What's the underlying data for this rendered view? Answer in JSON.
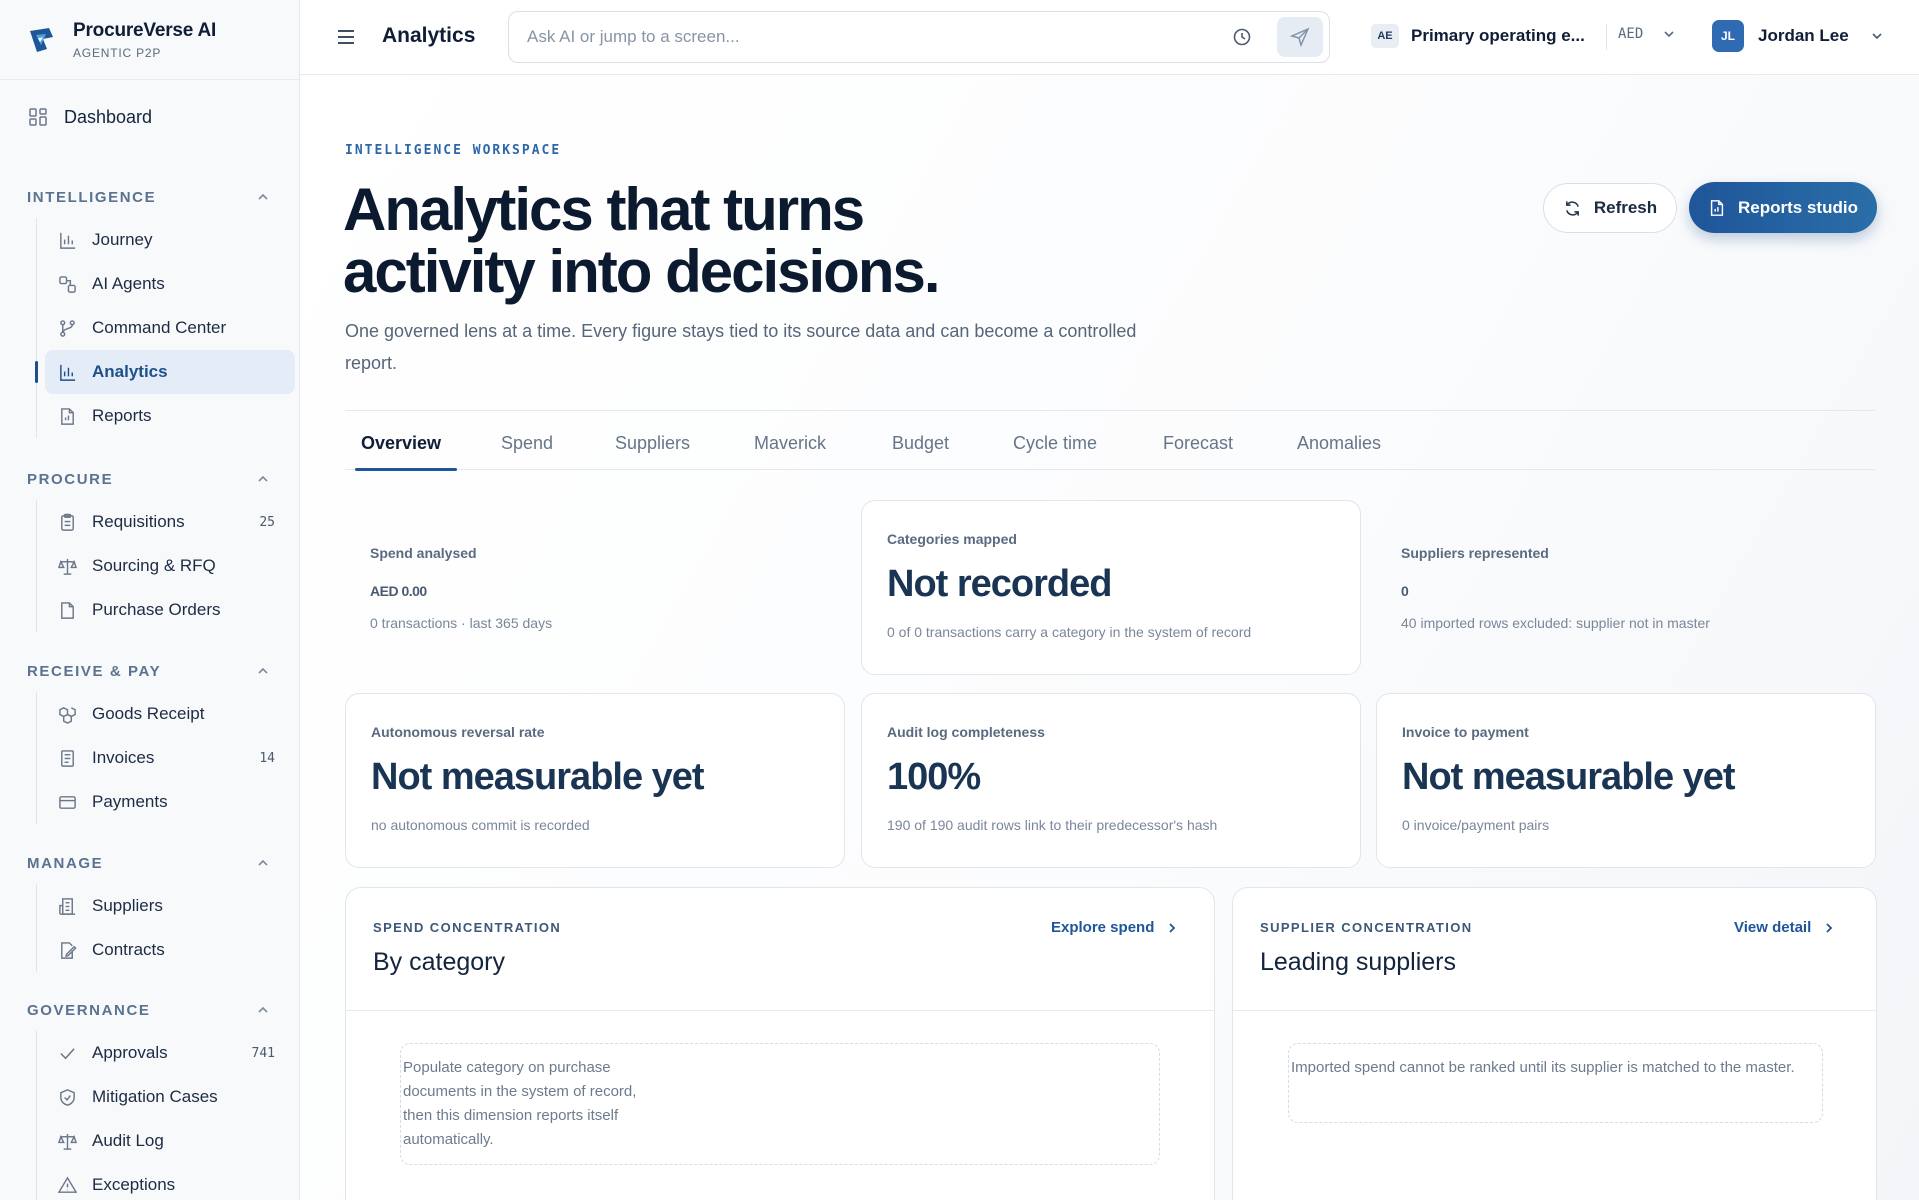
{
  "brand": {
    "name": "ProcureVerse AI",
    "subtitle": "AGENTIC P2P"
  },
  "sidebar": {
    "dashboard": "Dashboard",
    "sections": [
      {
        "title": "INTELLIGENCE",
        "items": [
          {
            "label": "Journey",
            "icon": "bar-chart-icon"
          },
          {
            "label": "AI Agents",
            "icon": "agents-icon"
          },
          {
            "label": "Command Center",
            "icon": "branch-icon"
          },
          {
            "label": "Analytics",
            "icon": "bar-chart-icon",
            "active": true
          },
          {
            "label": "Reports",
            "icon": "report-icon"
          }
        ]
      },
      {
        "title": "PROCURE",
        "items": [
          {
            "label": "Requisitions",
            "icon": "clipboard-icon",
            "count": "25"
          },
          {
            "label": "Sourcing & RFQ",
            "icon": "scale-icon"
          },
          {
            "label": "Purchase Orders",
            "icon": "document-icon"
          }
        ]
      },
      {
        "title": "RECEIVE & PAY",
        "items": [
          {
            "label": "Goods Receipt",
            "icon": "boxes-icon"
          },
          {
            "label": "Invoices",
            "icon": "invoice-icon",
            "count": "14"
          },
          {
            "label": "Payments",
            "icon": "card-icon"
          }
        ]
      },
      {
        "title": "MANAGE",
        "items": [
          {
            "label": "Suppliers",
            "icon": "building-icon"
          },
          {
            "label": "Contracts",
            "icon": "contract-icon"
          }
        ]
      },
      {
        "title": "GOVERNANCE",
        "items": [
          {
            "label": "Approvals",
            "icon": "check-icon",
            "count": "741"
          },
          {
            "label": "Mitigation Cases",
            "icon": "shield-icon"
          },
          {
            "label": "Audit Log",
            "icon": "scale-icon"
          },
          {
            "label": "Exceptions",
            "icon": "warning-icon"
          }
        ]
      }
    ]
  },
  "topbar": {
    "title": "Analytics",
    "search_placeholder": "Ask AI or jump to a screen...",
    "entity_badge": "AE",
    "entity_name": "Primary operating e...",
    "currency": "AED",
    "user_initials": "JL",
    "user_name": "Jordan Lee"
  },
  "hero": {
    "eyebrow": "INTELLIGENCE WORKSPACE",
    "title": "Analytics that turns activity into decisions.",
    "subtitle": "One governed lens at a time. Every figure stays tied to its source data and can become a controlled report.",
    "refresh_label": "Refresh",
    "reports_label": "Reports studio"
  },
  "tabs": [
    "Overview",
    "Spend",
    "Suppliers",
    "Maverick",
    "Budget",
    "Cycle time",
    "Forecast",
    "Anomalies"
  ],
  "kpis": {
    "spend": {
      "label": "Spend analysed",
      "value": "AED 0.00",
      "sub": "0 transactions · last 365 days"
    },
    "categories": {
      "label": "Categories mapped",
      "value": "Not recorded",
      "sub": "0 of 0 transactions carry a category in the system of record"
    },
    "suppliers": {
      "label": "Suppliers represented",
      "value": "0",
      "sub": "40 imported rows excluded: supplier not in master"
    },
    "reversal": {
      "label": "Autonomous reversal rate",
      "value": "Not measurable yet",
      "sub": "no autonomous commit is recorded"
    },
    "audit": {
      "label": "Audit log completeness",
      "value": "100%",
      "sub": "190 of 190 audit rows link to their predecessor's hash"
    },
    "invoice": {
      "label": "Invoice to payment",
      "value": "Not measurable yet",
      "sub": "0 invoice/payment pairs"
    }
  },
  "panels": {
    "category": {
      "eyebrow": "SPEND CONCENTRATION",
      "title": "By category",
      "link": "Explore spend",
      "empty": "Populate category on purchase documents in the system of record, then this dimension reports itself automatically."
    },
    "supplier": {
      "eyebrow": "SUPPLIER CONCENTRATION",
      "title": "Leading suppliers",
      "link": "View detail",
      "empty": "Imported spend cannot be ranked until its supplier is matched to the master."
    }
  },
  "colors": {
    "accent": "#1f5599",
    "ink": "#0c1a30",
    "muted": "#67758a"
  }
}
